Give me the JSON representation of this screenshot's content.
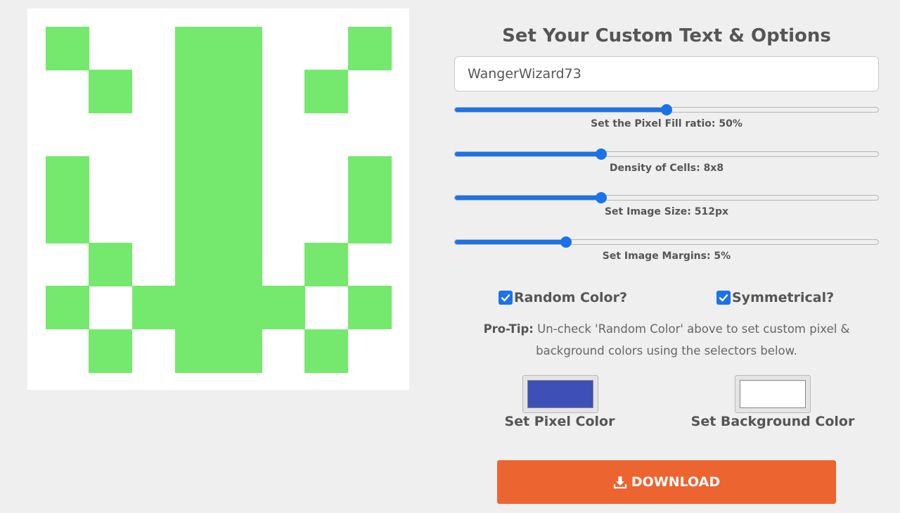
{
  "preview": {
    "grid_size": 8,
    "pixel_color": "#74e96d",
    "background_color": "#ffffff",
    "cells": [
      [
        1,
        0,
        0,
        1,
        1,
        0,
        0,
        1
      ],
      [
        0,
        1,
        0,
        1,
        1,
        0,
        1,
        0
      ],
      [
        0,
        0,
        0,
        1,
        1,
        0,
        0,
        0
      ],
      [
        1,
        0,
        0,
        1,
        1,
        0,
        0,
        1
      ],
      [
        1,
        0,
        0,
        1,
        1,
        0,
        0,
        1
      ],
      [
        0,
        1,
        0,
        1,
        1,
        0,
        1,
        0
      ],
      [
        1,
        0,
        1,
        1,
        1,
        1,
        0,
        1
      ],
      [
        0,
        1,
        0,
        1,
        1,
        0,
        1,
        0
      ]
    ]
  },
  "panel": {
    "title": "Set Your Custom Text & Options",
    "text_input": {
      "value": "WangerWizard73"
    },
    "sliders": [
      {
        "label": "Set the Pixel Fill ratio: 50%",
        "fraction": 0.5
      },
      {
        "label": "Density of Cells: 8x8",
        "fraction": 0.34
      },
      {
        "label": "Set Image Size: 512px",
        "fraction": 0.34
      },
      {
        "label": "Set Image Margins: 5%",
        "fraction": 0.255
      }
    ],
    "checkboxes": {
      "random_color": {
        "label": "Random Color?",
        "checked": true
      },
      "symmetrical": {
        "label": "Symmetrical?",
        "checked": true
      }
    },
    "protip": {
      "prefix": "Pro-Tip:",
      "line1": "Un-check 'Random Color' above to set custom pixel &",
      "line2": "background colors using the selectors below."
    },
    "pixel_color_picker": {
      "label": "Set Pixel Color",
      "value": "#3f4fb8"
    },
    "background_color_picker": {
      "label": "Set Background Color",
      "value": "#ffffff"
    },
    "download_button": {
      "label": "DOWNLOAD",
      "icon": "download-icon"
    },
    "accent_color": "#1a73e8",
    "button_color": "#ec6430"
  }
}
